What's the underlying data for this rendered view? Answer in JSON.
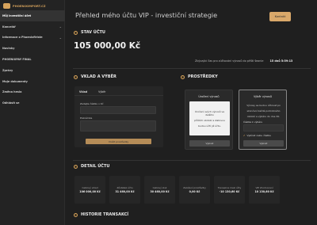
{
  "brand": {
    "name": "PHOENIXIMPORT.CZ"
  },
  "sidebar": {
    "items": [
      {
        "label": "Můj investiční účet",
        "chevron": false,
        "active": true
      },
      {
        "label": "Kancelář",
        "chevron": true
      },
      {
        "label": "Informace o Phoenixfiriste",
        "chevron": true
      },
      {
        "label": "Novinky",
        "chevron": false
      },
      {
        "label": "PHOENIXPAY FINAL",
        "chevron": false
      },
      {
        "label": "Zprávy",
        "chevron": false
      },
      {
        "label": "Moje dokumenty",
        "chevron": false
      },
      {
        "label": "Změna hesla",
        "chevron": false
      },
      {
        "label": "Odhlásit se",
        "chevron": false
      }
    ]
  },
  "header": {
    "title": "Přehled mého účtu VIP - investiční strategie",
    "contact_label": "Kontakt"
  },
  "account": {
    "section_title": "STAV ÚČTU",
    "balance": "105 000,00 Kč",
    "next_label": "Zbývající čas pro zúčtování výnosů do příští šeanie",
    "next_value": "15 dnů 5:59:13"
  },
  "deposit": {
    "section_title": "VKLAD A VÝBĚR",
    "tabs": [
      "Vklad",
      "Výběr"
    ],
    "amount_label": "Zadejte částku v Kč",
    "note_label": "Poznámka",
    "submit_label": "Vložit prostředky"
  },
  "funds": {
    "section_title": "PROSTŘEDKY",
    "cards": [
      {
        "title": "Úročení výnosů",
        "body": [
          "Úročení svých výnosů ve dalšího",
          "příštích období a zlatovou",
          "budou účtí již účtu."
        ],
        "button": "Vybrat",
        "active": false
      },
      {
        "title": "Výběr výnosů",
        "body": [
          "Výnosy se budou účtovat po",
          "skončení každé podrobného",
          "období a výběru do dne 30."
        ],
        "detail_label": "Částka k výběru",
        "check_label": "Vybírat celou částku",
        "button": "Vybrat",
        "active": true
      }
    ]
  },
  "details": {
    "section_title": "DETAIL ÚČTU",
    "stats": [
      {
        "label": "Celkový vklad",
        "value": "106 000,00 Kč"
      },
      {
        "label": "Zůstatek účtu",
        "value": "31 460,00 Kč"
      },
      {
        "label": "Celkový zisk",
        "value": "30 460,00 Kč"
      },
      {
        "label": "Založení prostředky",
        "value": "0,00 Kč"
      },
      {
        "label": "Transakce mezi účty",
        "value": "-10 130,60 Kč"
      },
      {
        "label": "VIP zhodnocení",
        "value": "10 130,60 Kč"
      }
    ]
  },
  "history": {
    "section_title": "HISTORIE TRANSAKCÍ"
  }
}
